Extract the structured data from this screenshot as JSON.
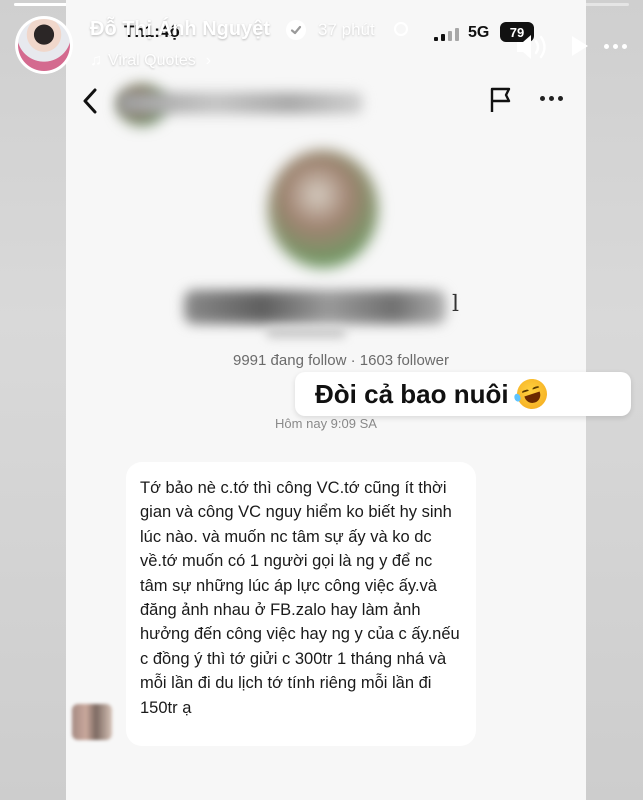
{
  "story": {
    "progress": 0.15,
    "author_name": "Đỗ Thị Ánh Nguyệt",
    "time_ago": "37 phút",
    "music_label": "Viral Quotes",
    "sticker_text": "Đòi cả bao nuôi"
  },
  "screenshot": {
    "status_time": "Th1:4ộ",
    "network": "5G",
    "battery": "79",
    "name_tail": "l",
    "follow_stats": "9991 đang follow · 1603 follower",
    "message_time": "Hôm nay 9:09 SA",
    "message_text": "Tớ bảo nè c.tớ thì công VC.tớ cũng ít thời gian và công VC nguy hiểm ko biết hy sinh lúc nào. và muốn nc tâm sự ấy và ko dc về.tớ muốn có 1 người gọi là ng y để nc tâm sự những lúc áp lực công việc ấy.và đăng ảnh nhau ở FB.zalo hay làm ảnh hưởng đến công việc hay ng y của c ấy.nếu c đồng ý thì tớ giửi c 300tr 1 tháng nhá và mỗi lần đi du lịch tớ tính riêng mỗi lần đi 150tr ạ"
  },
  "icons": {
    "back": "chevron-left-icon",
    "flag": "flag-icon",
    "more": "more-icon",
    "verified": "verified-icon",
    "globe": "globe-icon",
    "music": "music-note-icon",
    "volume": "volume-icon",
    "play": "play-icon",
    "emoji": "rolling-laughing-emoji"
  },
  "colors": {
    "background": "#d6d6d6",
    "bubble": "#ffffff",
    "card": "#f7f7f7"
  }
}
